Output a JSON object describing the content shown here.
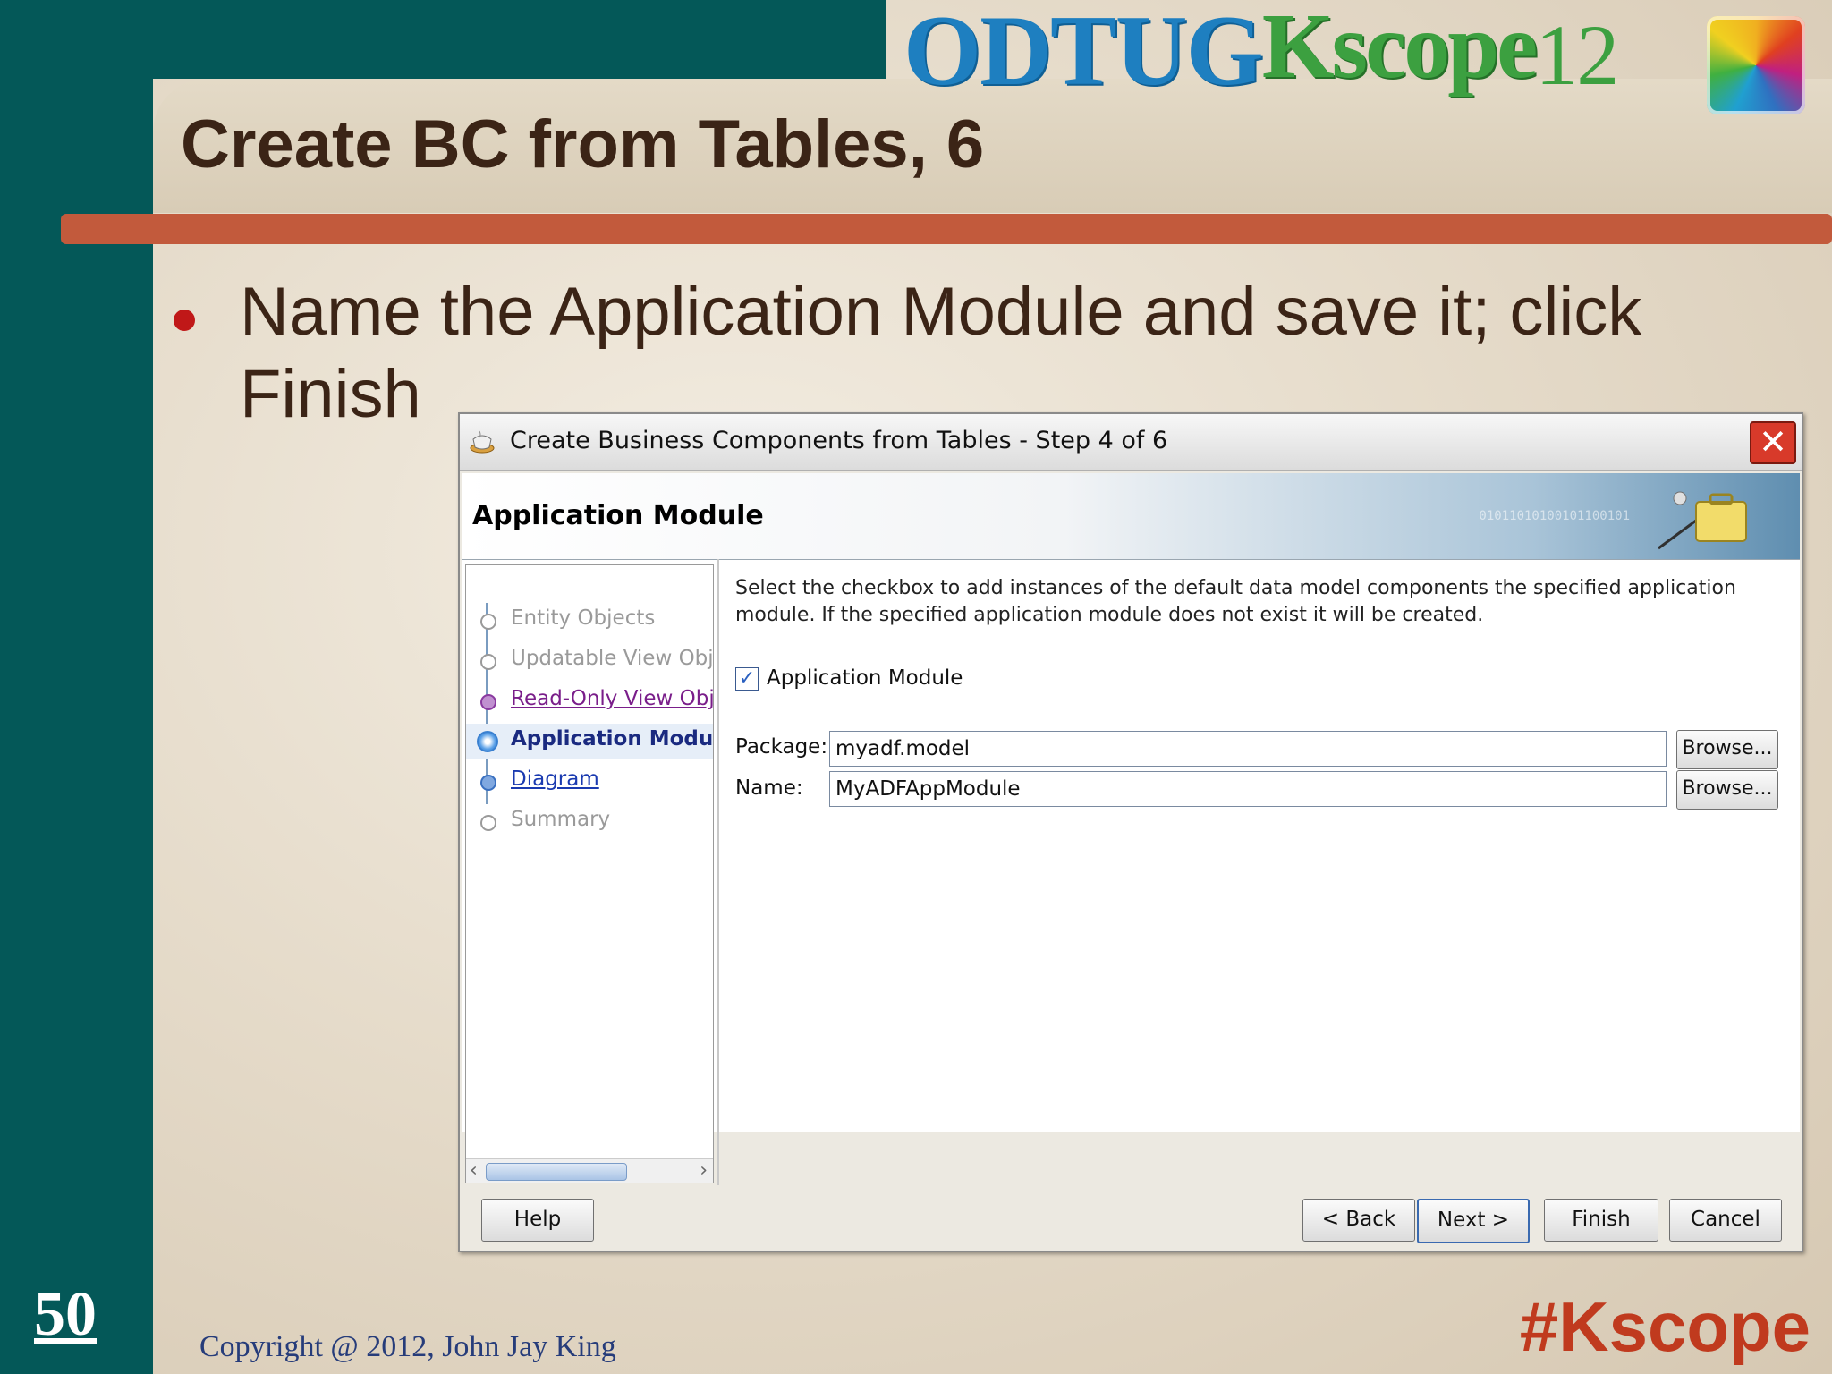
{
  "slide": {
    "title": "Create BC from Tables, 6",
    "bullet": "Name the Application Module and save it; click Finish",
    "page_number": "50",
    "copyright": "Copyright @ 2012, John Jay King",
    "hashtag": "#Kscope",
    "logo": {
      "part1": "ODTUG",
      "part2": "Kscope",
      "part3": "12"
    },
    "colors": {
      "sidebar": "#045858",
      "rule": "#c25a3c",
      "title": "#3b2416",
      "hashtag": "#c03a1e"
    }
  },
  "dialog": {
    "title": "Create Business Components from Tables - Step 4 of 6",
    "header": "Application Module",
    "nav_items": [
      {
        "label": "Entity Objects",
        "state": "disabled"
      },
      {
        "label": "Updatable View Obj",
        "state": "disabled"
      },
      {
        "label": "Read-Only View Obj",
        "state": "visited"
      },
      {
        "label": "Application Modul",
        "state": "current"
      },
      {
        "label": "Diagram",
        "state": "link"
      },
      {
        "label": "Summary",
        "state": "disabled"
      }
    ],
    "description": "Select the checkbox to add instances of the default data model components the specified application module.  If the specified application module does not exist it will be created.",
    "checkbox": {
      "label": "Application Module",
      "checked": true
    },
    "fields": {
      "package_label": "Package:",
      "package_value": "myadf.model",
      "name_label": "Name:",
      "name_value": "MyADFAppModule",
      "browse_label": "Browse..."
    },
    "buttons": {
      "help": "Help",
      "back": "< Back",
      "next": "Next >",
      "finish": "Finish",
      "cancel": "Cancel"
    }
  }
}
